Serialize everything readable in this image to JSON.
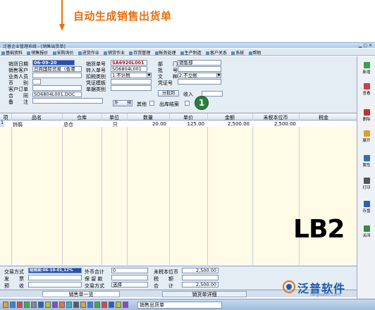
{
  "annotation": {
    "text": "自动生成销售出货单"
  },
  "window": {
    "title": "泛普企业管理系统 - [销售出货单]"
  },
  "menu": [
    "基础资料",
    "销售报价",
    "采购询价",
    "进货作业",
    "销货作业",
    "存货管理",
    "帐务处理",
    "生产制造",
    "客户关系",
    "系统",
    "帮助"
  ],
  "form": {
    "labels": {
      "sale_date": "销货日期",
      "customer": "销售客户",
      "salesperson": "业务人员",
      "currency": "币　　别",
      "customer_order": "客户订单",
      "contract": "合　　同",
      "remark": "备　　注",
      "order_no": "销货单号",
      "transfer_no": "转入单号",
      "tax_type": "扣税类别",
      "voucher_tpl": "凭证模板",
      "doc_type": "单据类别",
      "dept": "部　　门",
      "batch": "批　　号",
      "invoice": "文　　种",
      "voucher_no": "凭证号",
      "others": "其他",
      "outbound_done": "出库结案",
      "received": "收入"
    },
    "values": {
      "sale_date": "06-09-20",
      "customer": "日商国际贸易（香港",
      "order_no": "SA6920L001",
      "transfer_no": "SO6804L001",
      "tax_type": "1.不计税",
      "dept": "销售部",
      "invoice": "2.不立帐",
      "contract": "SO6804L001.DOC"
    },
    "buttons": {
      "confirm": "外　　预",
      "split": "分批到"
    },
    "badge": "1"
  },
  "grid": {
    "headers": [
      "项",
      "品名",
      "仓库",
      "单位",
      "数量",
      "单价",
      "金额",
      "未税本位币",
      "税金"
    ],
    "rows": [
      [
        "1",
        "铃鹃",
        "总仓",
        "只",
        "20.00",
        "125.00",
        "2,500.00",
        "2,500.00",
        ""
      ]
    ]
  },
  "overlay_label": "LB2",
  "footer": {
    "labels": {
      "trade_mode": "交易方式",
      "invoice": "发　　票",
      "receipt": "预　　收",
      "foreign_total": "外币合计",
      "warranty": "保 留 款",
      "trade_mode2": "交易方式",
      "untaxed": "未税本位币",
      "tax": "税　　额",
      "total": "合　　计"
    },
    "values": {
      "trade_mode": "结核期:06-10-01,12%",
      "foreign_total": "0",
      "untaxed": "2,500.00",
      "tax": "",
      "total": "2,500.00",
      "trade_mode2_value": "选择"
    }
  },
  "tabs": [
    "销售单一览",
    "销货单详细"
  ],
  "taskbar": {
    "text": "销售出货单"
  },
  "right_toolbar": [
    {
      "label": "新增",
      "icon": "new-icon",
      "color": "#3aa04a"
    },
    {
      "label": "查看",
      "icon": "view-icon",
      "color": "#d04040"
    },
    {
      "label": "删除",
      "icon": "delete-icon",
      "color": "#c03030"
    },
    {
      "label": "展开",
      "icon": "expand-icon",
      "color": "#e0a020"
    },
    {
      "label": "属性",
      "icon": "property-icon",
      "color": "#2f6fb8"
    },
    {
      "label": "打印",
      "icon": "print-icon",
      "color": "#555"
    },
    {
      "label": "存盘",
      "icon": "save-icon",
      "color": "#2f5fb0"
    },
    {
      "label": "关闭",
      "icon": "close-icon",
      "color": "#2f8f3f"
    }
  ],
  "logo": {
    "text": "泛普软件",
    "url": "fanpusoft.com"
  }
}
